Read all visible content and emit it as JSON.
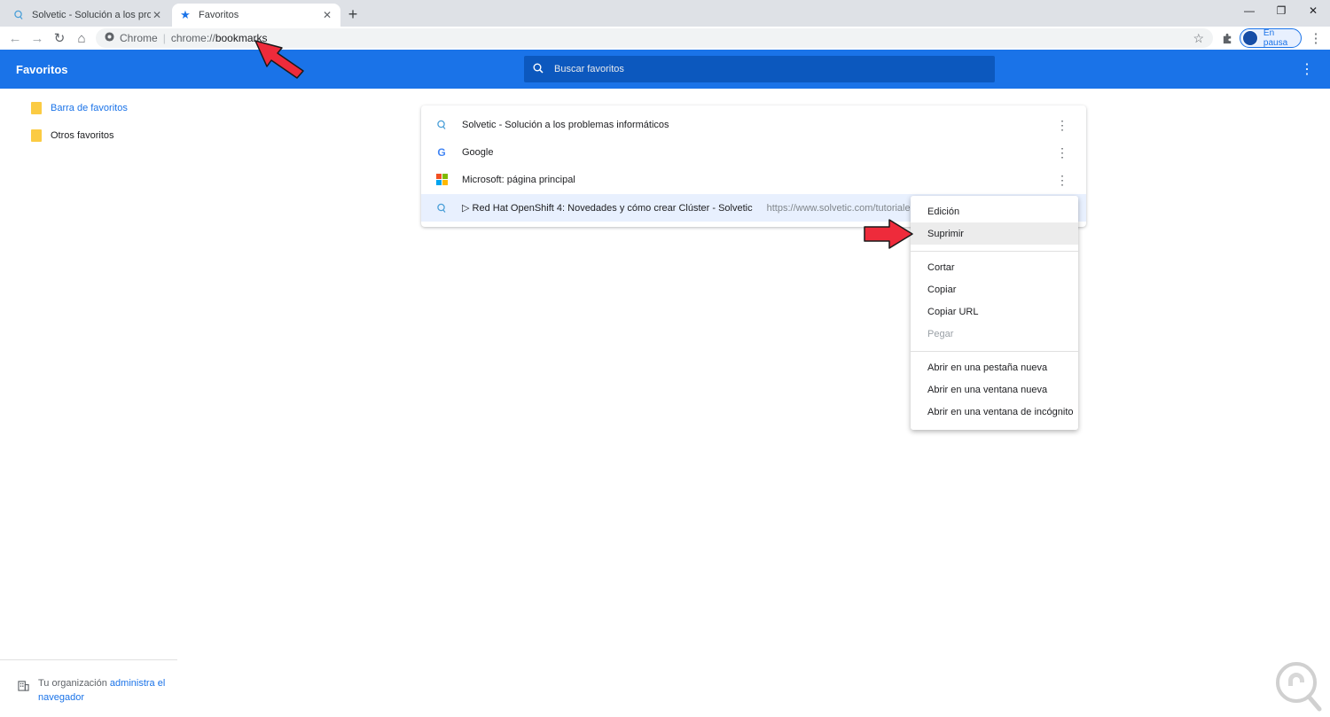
{
  "browser": {
    "tabs": [
      {
        "title": "Solvetic - Solución a los problem",
        "active": false
      },
      {
        "title": "Favoritos",
        "active": true
      }
    ],
    "new_tab": "+",
    "window_controls": {
      "minimize": "—",
      "maximize": "❐",
      "close": "✕"
    },
    "toolbar": {
      "back": "←",
      "forward": "→",
      "reload": "↻",
      "home": "⌂",
      "site_label": "Chrome",
      "url_scheme": "chrome://",
      "url_host": "bookmarks",
      "star": "☆",
      "extensions": "puzzle-icon",
      "profile_label": "En pausa",
      "menu": "⋮"
    }
  },
  "header": {
    "title": "Favoritos",
    "search_placeholder": "Buscar favoritos",
    "menu": "⋮"
  },
  "sidebar": {
    "folders": [
      {
        "label": "Barra de favoritos",
        "selected": true
      },
      {
        "label": "Otros favoritos",
        "selected": false
      }
    ],
    "org_text": "Tu organización",
    "org_link": "administra el",
    "org_text2": "navegador"
  },
  "bookmarks": [
    {
      "name": "Solvetic - Solución a los problemas informáticos",
      "url": "",
      "icon": "solvetic-icon"
    },
    {
      "name": "Google",
      "url": "",
      "icon": "google-icon"
    },
    {
      "name": "Microsoft: página principal",
      "url": "",
      "icon": "microsoft-icon"
    },
    {
      "name": "▷ Red Hat OpenShift 4: Novedades y cómo crear Clúster - Solvetic",
      "url": "https://www.solvetic.com/tutoriales/article",
      "icon": "solvetic-icon"
    }
  ],
  "context_menu": {
    "group1": [
      "Edición",
      "Suprimir"
    ],
    "group2": [
      "Cortar",
      "Copiar",
      "Copiar URL",
      "Pegar"
    ],
    "group3": [
      "Abrir en una pestaña nueva",
      "Abrir en una ventana nueva",
      "Abrir en una ventana de incógnito"
    ]
  },
  "colors": {
    "accent": "#1a73e8",
    "header_bg": "#1a73e8",
    "search_bg": "#0c58be",
    "arrow": "#ee2b3b",
    "folder": "#fbcb43"
  }
}
